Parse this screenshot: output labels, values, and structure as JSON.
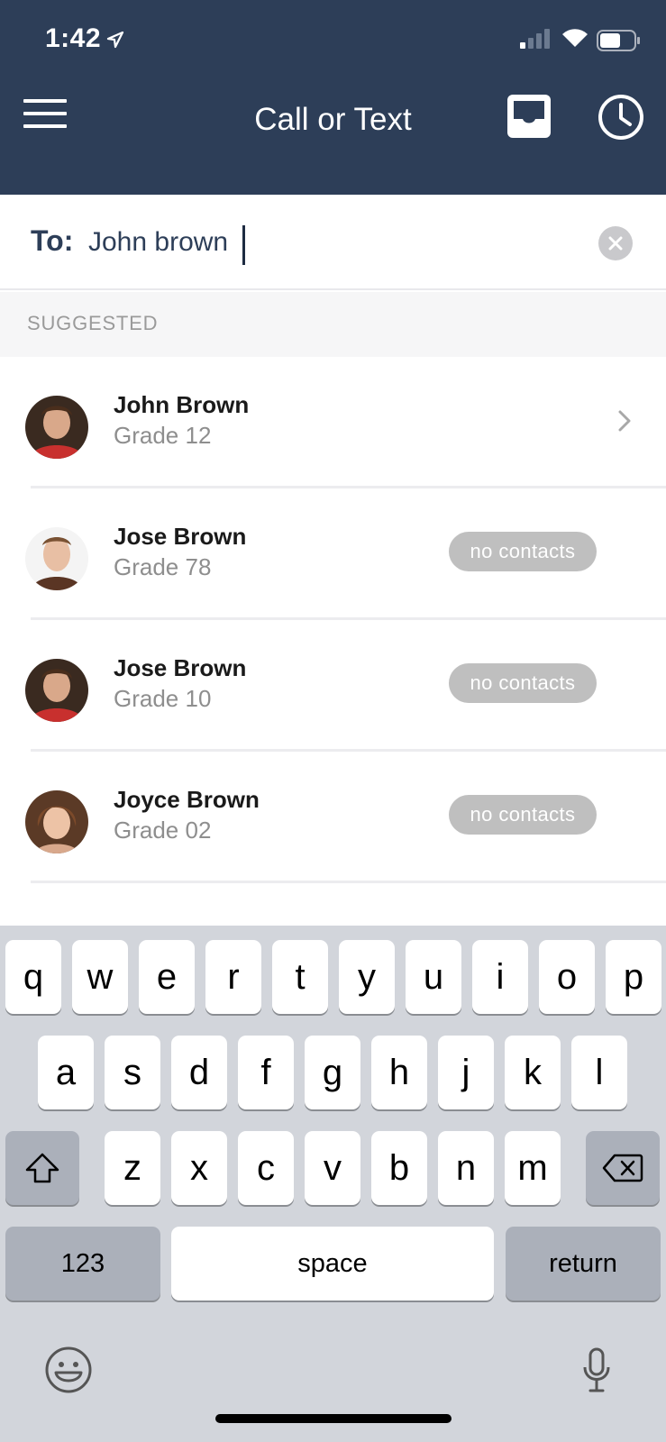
{
  "status_bar": {
    "time": "1:42"
  },
  "header": {
    "title": "Call or Text"
  },
  "to_field": {
    "label": "To:",
    "value": "John brown"
  },
  "suggested": {
    "label": "SUGGESTED"
  },
  "contacts": [
    {
      "name": "John Brown",
      "grade": "Grade 12",
      "badge": ""
    },
    {
      "name": "Jose Brown",
      "grade": "Grade 78",
      "badge": "no contacts"
    },
    {
      "name": "Jose Brown",
      "grade": "Grade 10",
      "badge": "no contacts"
    },
    {
      "name": "Joyce Brown",
      "grade": "Grade 02",
      "badge": "no contacts"
    }
  ],
  "keyboard": {
    "row1": [
      "q",
      "w",
      "e",
      "r",
      "t",
      "y",
      "u",
      "i",
      "o",
      "p"
    ],
    "row2": [
      "a",
      "s",
      "d",
      "f",
      "g",
      "h",
      "j",
      "k",
      "l"
    ],
    "row3": [
      "z",
      "x",
      "c",
      "v",
      "b",
      "n",
      "m"
    ],
    "numbers_label": "123",
    "space_label": "space",
    "return_label": "return"
  },
  "colors": {
    "header_bg": "#2d3e58",
    "accent_text": "#2d3e58",
    "badge_bg": "#bfbfbf"
  }
}
